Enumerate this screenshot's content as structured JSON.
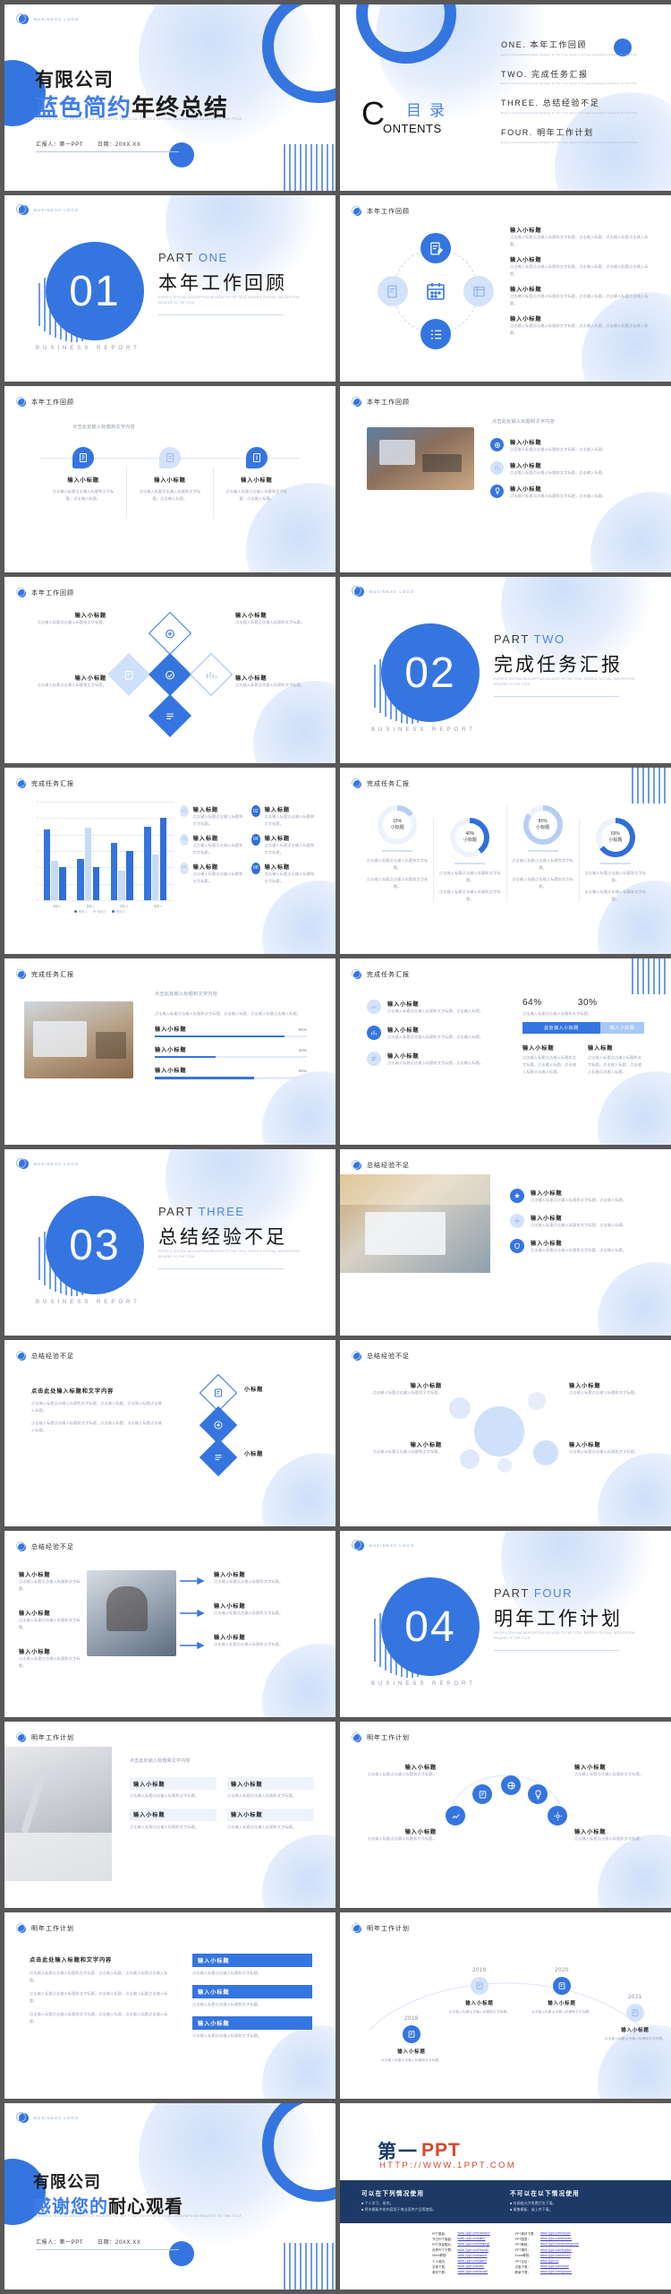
{
  "brand": {
    "accent": "#3575e0",
    "accent_light": "#b9d0f5",
    "dark": "#1d3a66",
    "red": "#d9472b"
  },
  "logo_text": "BUSINESS LOGO",
  "cover": {
    "company": "有限公司",
    "title_blue": "蓝色简约",
    "title_black": "年终总结",
    "subtitle": "ENTER A TEXTUAL DESCRIPTION RELATED TO THE TITLE. ENTER A TEXTUAL DESCRIPTION RELATED TO THE TITLE.",
    "presenter_label": "汇报人：第一PPT",
    "date_label": "日期：20XX.XX"
  },
  "contents": {
    "c_letter": "C",
    "ontents": "ONTENTS",
    "cn": "目录",
    "items": [
      {
        "no": "ONE.",
        "label": "本年工作回顾",
        "desc": "Enter A Textual Description Related To The Title. Enter A Textual Description Related To The Title"
      },
      {
        "no": "TWO.",
        "label": "完成任务汇报",
        "desc": "Enter A Textual Description Related To The Title. Enter A Textual Description Related To The Title"
      },
      {
        "no": "THREE.",
        "label": "总结经验不足",
        "desc": "Enter A Textual Description Related To The Title. Enter A Textual Description Related To The Title"
      },
      {
        "no": "FOUR.",
        "label": "明年工作计划",
        "desc": "Enter A Textual Description Related To The Title. Enter A Textual Description Related To The Title"
      }
    ]
  },
  "sections": [
    {
      "num": "01",
      "part": "PART ",
      "part_en": "ONE",
      "cn": "本年工作回顾",
      "en": "ENTER A TEXTUAL DESCRIPTION RELATED TO THE TITLE. ENTER A TEXTUAL DESCRIPTION RELATED TO THE TITLE",
      "br": "BUSINESS REPORT"
    },
    {
      "num": "02",
      "part": "PART ",
      "part_en": "TWO",
      "cn": "完成任务汇报",
      "en": "ENTER A TEXTUAL DESCRIPTION RELATED TO THE TITLE. ENTER A TEXTUAL DESCRIPTION RELATED TO THE TITLE",
      "br": "BUSINESS REPORT"
    },
    {
      "num": "03",
      "part": "PART ",
      "part_en": "THREE",
      "cn": "总结经验不足",
      "en": "ENTER A TEXTUAL DESCRIPTION RELATED TO THE TITLE. ENTER A TEXTUAL DESCRIPTION RELATED TO THE TITLE",
      "br": "BUSINESS REPORT"
    },
    {
      "num": "04",
      "part": "PART ",
      "part_en": "FOUR",
      "cn": "明年工作计划",
      "en": "ENTER A TEXTUAL DESCRIPTION RELATED TO THE TITLE. ENTER A TEXTUAL DESCRIPTION RELATED TO THE TITLE",
      "br": "BUSINESS REPORT"
    }
  ],
  "headers": {
    "h1": "本年工作回顾",
    "h2": "完成任务汇报",
    "h3": "总结经验不足",
    "h4": "明年工作计划"
  },
  "common": {
    "sub": "输入小标题",
    "title_plain": "输入标题",
    "lead": "点击此处输入标题和文字内容",
    "body": "点击输入标题点击输入标题和文字标题，点击输入标题，点击输入标题点击输入标题。",
    "body_short": "点击输入标题点击输入标题和文字标题，点击输入标题。",
    "body_tiny": "点击输入标题点击输入标题和文字标题。",
    "small_title": "小标题",
    "here_sub": "此处输入小标题"
  },
  "chart_data": {
    "type": "bar",
    "title": "",
    "categories": [
      "类别 1",
      "类别 2",
      "类别 3",
      "类别 4"
    ],
    "series": [
      {
        "name": "系列 1",
        "color": "#3575e0",
        "values": [
          4.3,
          2.5,
          3.5,
          4.5
        ]
      },
      {
        "name": "系列 2",
        "color": "#c7daf8",
        "values": [
          2.4,
          4.4,
          1.8,
          2.8
        ]
      },
      {
        "name": "系列 3",
        "color": "#2f6fd8",
        "values": [
          2.0,
          2.0,
          3.0,
          5.0
        ]
      }
    ],
    "ylim": [
      0,
      6
    ],
    "yticks": [
      "0",
      "1",
      "2",
      "3",
      "4",
      "5",
      "6"
    ],
    "grid": true,
    "legend": "bottom",
    "xlabel": "",
    "ylabel": ""
  },
  "donuts": {
    "type": "donut-set",
    "items": [
      {
        "value": 15,
        "pct": "15%",
        "label": "小标题"
      },
      {
        "value": 40,
        "pct": "40%",
        "label": "小标题"
      },
      {
        "value": 85,
        "pct": "85%",
        "label": "小标题"
      },
      {
        "value": 65,
        "pct": "65%",
        "label": "小标题"
      }
    ]
  },
  "progress": {
    "items": [
      {
        "label": "输入小标题",
        "pct": "85%",
        "value": 85
      },
      {
        "label": "输入小标题",
        "pct": "40%",
        "value": 40
      },
      {
        "label": "输入小标题",
        "pct": "65%",
        "value": 65
      }
    ]
  },
  "two_stat": {
    "a_pct": "64%",
    "b_pct": "30%",
    "desc": "点击输入标题点击输入标题和文字标题。",
    "a_btn": "此处输入小标题",
    "b_btn": "输入小标题",
    "a_title": "输入小标题",
    "b_title": "输入标题"
  },
  "numbered": {
    "items": [
      {
        "no": "01",
        "label": "输入标题",
        "desc": "点击输入标题点击输入标题和文字标题。"
      },
      {
        "no": "02",
        "label": "输入标题",
        "desc": "点击输入标题点击输入标题和文字标题。"
      },
      {
        "no": "03",
        "label": "输入标题",
        "desc": "点击输入标题点击输入标题和文字标题。"
      },
      {
        "no": "04",
        "label": "输入标题",
        "desc": "点击输入标题点击输入标题和文字标题。"
      },
      {
        "no": "05",
        "label": "输入标题",
        "desc": "点击输入标题点击输入标题和文字标题。"
      },
      {
        "no": "06",
        "label": "输入标题",
        "desc": "点击输入标题点击输入标题和文字标题。"
      }
    ]
  },
  "timeline": {
    "years": [
      "2018",
      "2019",
      "2020",
      "2021"
    ],
    "label": "输入小标题"
  },
  "thanks": {
    "company": "有限公司",
    "line_blue": "感谢您的",
    "line_black": "耐心观看",
    "subtitle": "ENTER A TEXTUAL DESCRIPTION RELATED TO THE TITLE. ENTER A TEXTUAL DESCRIPTION RELATED TO THE TITLE.",
    "presenter_label": "汇报人：第一PPT",
    "date_label": "日期：20XX.XX"
  },
  "footer_page": {
    "brand_cn": "第一",
    "brand_en": "PPT",
    "url": "HTTP://WWW.1PPT.COM",
    "allow_title": "可以在下列情况使用",
    "allow_items": [
      "个人学习、研究。",
      "将本模板中的内容用于商业宣传产品等使用。"
    ],
    "deny_title": "不可以在以下情况使用",
    "deny_items": [
      "在网络允许免费打包下载。",
      "贩售模板、或上传下载。"
    ],
    "links_left": [
      {
        "k": "PPT模板：",
        "v": "www.1ppt.com/moban/"
      },
      {
        "k": "节日PPT模板：",
        "v": "www.1ppt.com/jieri/"
      },
      {
        "k": "PPT背景图片：",
        "v": "www.1ppt.com/beijing/"
      },
      {
        "k": "优秀PPT下载：",
        "v": "www.1ppt.com/xiazai/"
      },
      {
        "k": "Word教程：",
        "v": "www.1ppt.com/word/"
      },
      {
        "k": "个人简历：",
        "v": "www.1ppt.com/jianli/"
      },
      {
        "k": "字体下载：",
        "v": "www.1ppt.com/ziti/"
      },
      {
        "k": "素材下载：",
        "v": "www.1ppt.com/sucai/"
      }
    ],
    "links_right": [
      {
        "k": "PPT素材下载：",
        "v": "www.1ppt.com/sucai/"
      },
      {
        "k": "PPT图表：",
        "v": "www.1ppt.com/tubiao/"
      },
      {
        "k": "PPT教程：",
        "v": "www.1ppt.com/powerpoint/"
      },
      {
        "k": "PPT课件：",
        "v": "www.1ppt.com/kejian/"
      },
      {
        "k": "Excel教程：",
        "v": "www.1ppt.com/excel/"
      },
      {
        "k": "PPT论坛：",
        "v": "www.1ppt.cn"
      },
      {
        "k": "试卷下载：",
        "v": "www.1ppt.com/shiti/"
      },
      {
        "k": "教案下载：",
        "v": "www.1ppt.com/jiaoan/"
      }
    ]
  }
}
